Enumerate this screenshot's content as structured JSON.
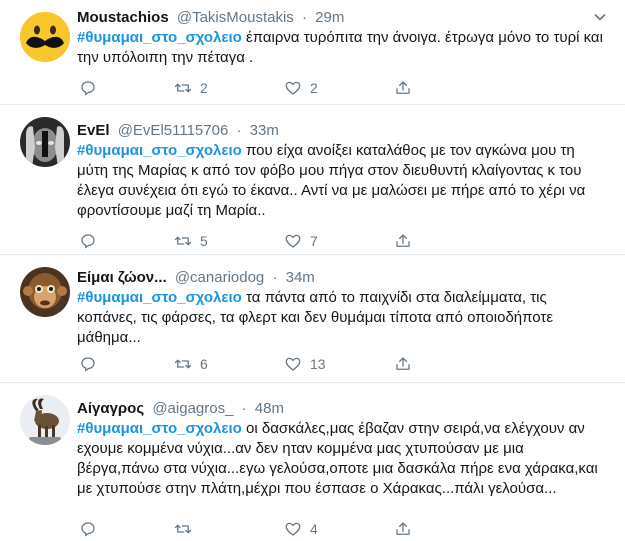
{
  "tweets": [
    {
      "display_name": "Moustachios",
      "handle": "@TakisMoustakis",
      "separator": "·",
      "time": "29m",
      "hashtag": "#θυμαμαι_στο_σχολειο",
      "text": " έπαιρνα τυρόπιτα την άνοιγα. έτρωγα μόνο το τυρί και την υπόλοιπη την πέταγα .",
      "retweets": "2",
      "likes": "2",
      "avatar": "moustache-emoji"
    },
    {
      "display_name": "EvEl",
      "handle": "@EvEl51115706",
      "separator": "·",
      "time": "33m",
      "hashtag": "#θυμαμαι_στο_σχολειο",
      "text": " που είχα ανοίξει καταλάθος με τον αγκώνα μου τη μύτη της Μαρίας κ από τον φόβο μου πήγα στον διευθυντή κλαίγοντας κ του έλεγα συνέχεια ότι εγώ το έκανα.. Αντί να με μαλώσει με πήρε από το χέρι να φροντίσουμε μαζί τη Μαρία..",
      "retweets": "5",
      "likes": "7",
      "avatar": "bw-face-hands"
    },
    {
      "display_name": "Είμαι ζώον...",
      "handle": "@canariodog",
      "separator": "·",
      "time": "34m",
      "hashtag": "#θυμαμαι_στο_σχολειο",
      "text": " τα πάντα από το παιχνίδι στα διαλείμματα, τις κοπάνες, τις φάρσες, τα φλερτ και δεν θυμάμαι τίποτα από οποιοδήποτε μάθημα...",
      "retweets": "6",
      "likes": "13",
      "avatar": "monkey"
    },
    {
      "display_name": "Αίγαγρος",
      "handle": "@aigagros_",
      "separator": "·",
      "time": "48m",
      "hashtag": "#θυμαμαι_στο_σχολειο",
      "text": " οι δασκάλες,μας έβαζαν στην σειρά,να ελέγχουν αν εχουμε κομμένα νύχια...αν δεν ηταν κομμένα μας χτυπούσαν με μια βέργα,πάνω στα νύχια...εγω γελούσα,οποτε μια δασκάλα πήρε ενα χάρακα,και με χτυπούσε στην πλάτη,μέχρι που έσπασε ο Χάρακας...πάλι γελούσα...",
      "retweets": "",
      "likes": "4",
      "avatar": "ibex-goat"
    }
  ],
  "colors": {
    "hashtag": "#1b95e0",
    "secondary": "#657786",
    "divider": "#e6ecf0"
  }
}
